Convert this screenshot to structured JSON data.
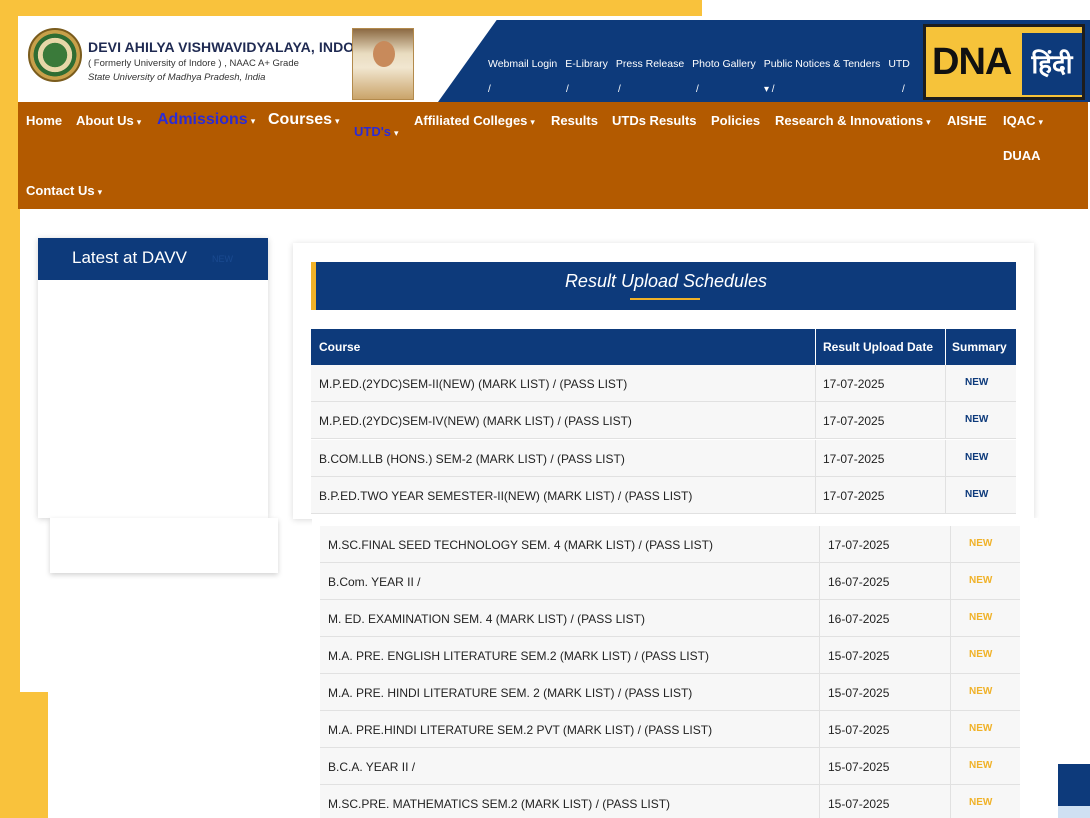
{
  "header": {
    "university_name": "DEVI AHILYA VISHWAVIDYALAYA, INDORE",
    "subtitle": "( Formerly University of Indore ) , NAAC A+ Grade",
    "state": "State University of Madhya Pradesh, India",
    "top_links": [
      "Webmail Login",
      "E-Library",
      "Press Release",
      "Photo Gallery",
      "Public Notices & Tenders",
      "UTD"
    ],
    "badge_text": "DNA",
    "badge_hindi": "हिंदी"
  },
  "nav": {
    "items": [
      {
        "label": "Home"
      },
      {
        "label": "About Us"
      },
      {
        "label": "Admissions"
      },
      {
        "label": "Courses"
      },
      {
        "label": "UTD's"
      },
      {
        "label": "Affiliated Colleges"
      },
      {
        "label": "Results"
      },
      {
        "label": "UTDs Results"
      },
      {
        "label": "Policies"
      },
      {
        "label": "Research & Innovations"
      },
      {
        "label": "AISHE"
      },
      {
        "label": "IQAC"
      },
      {
        "label": "DUAA"
      },
      {
        "label": "Contact Us"
      }
    ]
  },
  "sidebar": {
    "title": "Latest at DAVV",
    "new_tag": "NEW"
  },
  "results": {
    "title": "Result Upload Schedules",
    "columns": [
      "Course",
      "Result Upload Date",
      "Summary"
    ],
    "rows_upper": [
      {
        "course": "M.P.ED.(2YDC)SEM-II(NEW) (MARK LIST) / (PASS LIST)",
        "date": "17-07-2025",
        "summary": "NEW"
      },
      {
        "course": "M.P.ED.(2YDC)SEM-IV(NEW) (MARK LIST) / (PASS LIST)",
        "date": "17-07-2025",
        "summary": "NEW"
      },
      {
        "course": "B.COM.LLB (HONS.) SEM-2 (MARK LIST) / (PASS LIST)",
        "date": "17-07-2025",
        "summary": "NEW"
      },
      {
        "course": "B.P.ED.TWO YEAR SEMESTER-II(NEW) (MARK LIST) / (PASS LIST)",
        "date": "17-07-2025",
        "summary": "NEW"
      }
    ],
    "rows_lower": [
      {
        "course": "M.SC.FINAL SEED TECHNOLOGY SEM. 4 (MARK LIST) / (PASS LIST)",
        "date": "17-07-2025",
        "summary": "NEW"
      },
      {
        "course": "B.Com. YEAR II /",
        "date": "16-07-2025",
        "summary": "NEW"
      },
      {
        "course": "M. ED. EXAMINATION SEM. 4 (MARK LIST) / (PASS LIST)",
        "date": "16-07-2025",
        "summary": "NEW"
      },
      {
        "course": "M.A. PRE. ENGLISH LITERATURE SEM.2 (MARK LIST) / (PASS LIST)",
        "date": "15-07-2025",
        "summary": "NEW"
      },
      {
        "course": "M.A. PRE. HINDI LITERATURE SEM. 2 (MARK LIST) / (PASS LIST)",
        "date": "15-07-2025",
        "summary": "NEW"
      },
      {
        "course": "M.A. PRE.HINDI LITERATURE SEM.2 PVT (MARK LIST) / (PASS LIST)",
        "date": "15-07-2025",
        "summary": "NEW"
      },
      {
        "course": "B.C.A. YEAR II /",
        "date": "15-07-2025",
        "summary": "NEW"
      },
      {
        "course": "M.SC.PRE. MATHEMATICS SEM.2 (MARK LIST) / (PASS LIST)",
        "date": "15-07-2025",
        "summary": "NEW"
      }
    ]
  },
  "colors": {
    "nav_bg": "#b35a00",
    "primary_blue": "#0d3a7b",
    "accent_yellow": "#f9c23c"
  }
}
